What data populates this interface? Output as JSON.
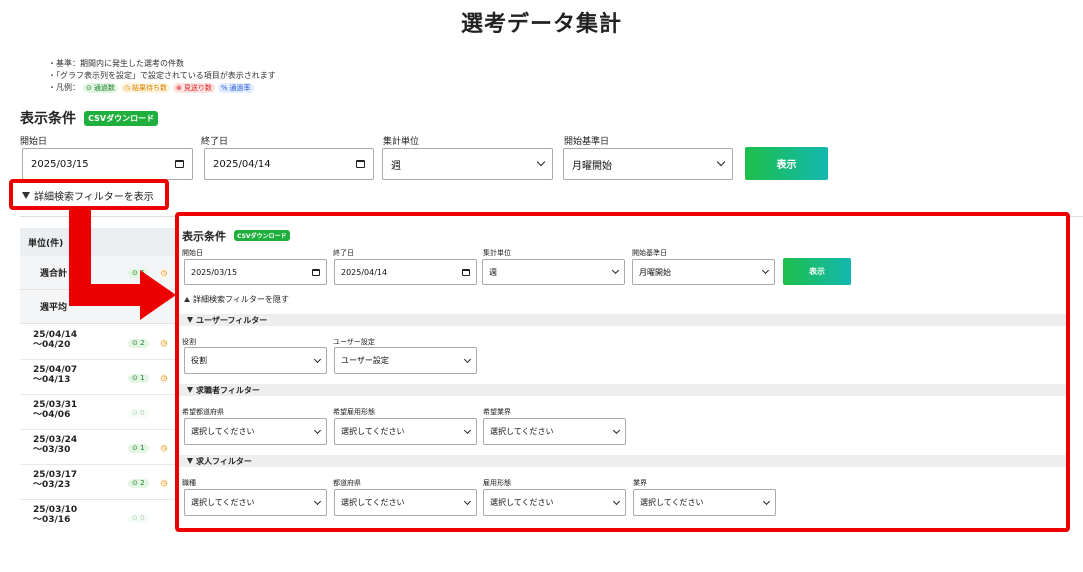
{
  "page": {
    "title": "選考データ集計"
  },
  "notes": {
    "line1": "・基準：期間内に発生した選考の件数",
    "line2": "・「グラフ表示列を設定」で設定されている項目が表示されます",
    "legend_prefix": "・凡例：",
    "legend": [
      {
        "icon": "check-circle-icon",
        "label": "通過数",
        "color": "#1b7f2a"
      },
      {
        "icon": "clock-icon",
        "label": "結果待ち数",
        "color": "#d98200"
      },
      {
        "icon": "x-circle-icon",
        "label": "見送り数",
        "color": "#dd2222"
      },
      {
        "icon": "percent-icon",
        "label": "通過率",
        "color": "#2a5bd7"
      }
    ]
  },
  "conditions": {
    "title": "表示条件",
    "csv_label": "CSVダウンロード",
    "start_label": "開始日",
    "start_value": "2025/03/15",
    "end_label": "終了日",
    "end_value": "2025/04/14",
    "unit_label": "集計単位",
    "unit_value": "週",
    "base_label": "開始基準日",
    "base_value": "月曜開始",
    "show_button": "表示",
    "filter_toggle_show": "詳細検索フィルターを表示"
  },
  "table": {
    "unit_header": "単位(件)",
    "sum_label": "週合計",
    "avg_label": "週平均",
    "sum_pass": "6",
    "rows": [
      {
        "line1": "25/04/14",
        "line2": "～04/20",
        "pass": "2",
        "faded": false
      },
      {
        "line1": "25/04/07",
        "line2": "～04/13",
        "pass": "1",
        "faded": false
      },
      {
        "line1": "25/03/31",
        "line2": "～04/06",
        "pass": "0",
        "faded": true
      },
      {
        "line1": "25/03/24",
        "line2": "～03/30",
        "pass": "1",
        "faded": false
      },
      {
        "line1": "25/03/17",
        "line2": "～03/23",
        "pass": "2",
        "faded": false
      },
      {
        "line1": "25/03/10",
        "line2": "～03/16",
        "pass": "0",
        "faded": true
      }
    ]
  },
  "panel": {
    "title": "表示条件",
    "csv_label": "CSVダウンロード",
    "start_label": "開始日",
    "start_value": "2025/03/15",
    "end_label": "終了日",
    "end_value": "2025/04/14",
    "unit_label": "集計単位",
    "unit_value": "週",
    "base_label": "開始基準日",
    "base_value": "月曜開始",
    "show_button": "表示",
    "filter_toggle_hide": "詳細検索フィルターを隠す",
    "user_filter": {
      "title": "ユーザーフィルター",
      "role_label": "役割",
      "role_value": "役割",
      "user_label": "ユーザー設定",
      "user_value": "ユーザー設定"
    },
    "applicant_filter": {
      "title": "求職者フィルター",
      "pref_label": "希望都道府県",
      "pref_value": "選択してください",
      "emp_label": "希望雇用形態",
      "emp_value": "選択してください",
      "industry_label": "希望業界",
      "industry_value": "選択してください"
    },
    "job_filter": {
      "title": "求人フィルター",
      "job_label": "職種",
      "job_value": "選択してください",
      "pref_label": "都道府県",
      "pref_value": "選択してください",
      "emp_label": "雇用形態",
      "emp_value": "選択してください",
      "industry_label": "業界",
      "industry_value": "選択してください"
    }
  },
  "colors": {
    "accent_green": "#1faf3c",
    "highlight_red": "#ee0000",
    "button_gradient_end": "#14b7b0"
  }
}
